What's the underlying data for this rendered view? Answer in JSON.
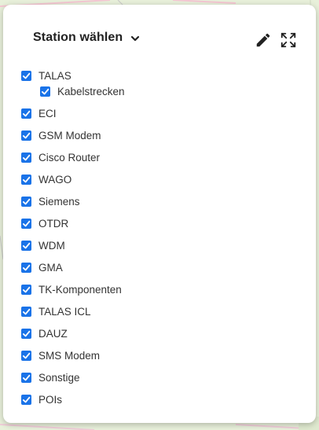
{
  "header": {
    "station_label": "Station wählen"
  },
  "icons": {
    "dropdown": "chevron-down-icon",
    "edit": "pencil-icon",
    "fullscreen": "expand-icon",
    "checkbox": "checkmark-icon"
  },
  "colors": {
    "checkbox": "#1a73e8",
    "panel": "#ffffff",
    "map": "#e6efd6"
  },
  "layers": [
    {
      "label": "TALAS",
      "checked": true
    },
    {
      "label": "Kabelstrecken",
      "checked": true,
      "sub": true
    },
    {
      "label": "ECI",
      "checked": true
    },
    {
      "label": "GSM Modem",
      "checked": true
    },
    {
      "label": "Cisco Router",
      "checked": true
    },
    {
      "label": "WAGO",
      "checked": true
    },
    {
      "label": "Siemens",
      "checked": true
    },
    {
      "label": "OTDR",
      "checked": true
    },
    {
      "label": "WDM",
      "checked": true
    },
    {
      "label": "GMA",
      "checked": true
    },
    {
      "label": "TK-Komponenten",
      "checked": true
    },
    {
      "label": "TALAS ICL",
      "checked": true
    },
    {
      "label": "DAUZ",
      "checked": true
    },
    {
      "label": "SMS Modem",
      "checked": true
    },
    {
      "label": "Sonstige",
      "checked": true
    },
    {
      "label": "POIs",
      "checked": true
    }
  ]
}
